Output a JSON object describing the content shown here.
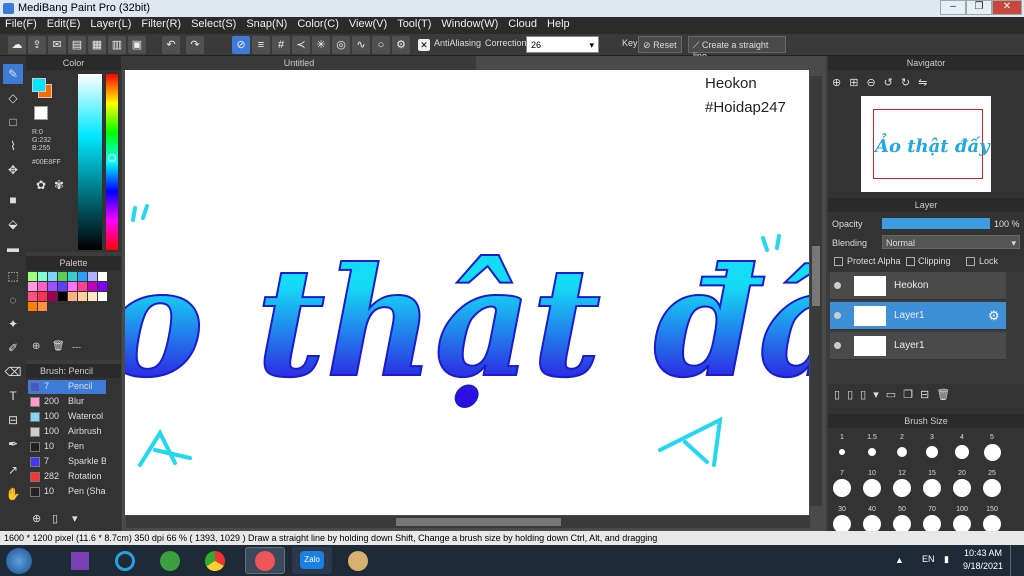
{
  "window": {
    "title": "MediBang Paint Pro (32bit)"
  },
  "menu": [
    "File(F)",
    "Edit(E)",
    "Layer(L)",
    "Filter(R)",
    "Select(S)",
    "Snap(N)",
    "Color(C)",
    "View(V)",
    "Tool(T)",
    "Window(W)",
    "Cloud",
    "Help"
  ],
  "toolbar": {
    "antialias_label": "AntiAliasing",
    "correction_label": "Correction",
    "correction_value": "26",
    "key_label": "Key",
    "reset_label": "Reset",
    "straight_label": "Create a straight line"
  },
  "canvas": {
    "title": "Untitled",
    "watermark_line1": "Heokon",
    "watermark_line2": "#Hoidap247",
    "artwork_text": "Ảo thật đấy"
  },
  "color": {
    "title": "Color",
    "r": "R:0",
    "g": "G:232",
    "b": "B:255",
    "hex": "#00E8FF",
    "primary": "#00E8FF",
    "secondary": "#FF6A00"
  },
  "palette": {
    "title": "Palette",
    "dash": "---",
    "swatches": [
      "#9dff7a",
      "#7dffcf",
      "#7dd6ff",
      "#58d058",
      "#30d0d0",
      "#2aa0ff",
      "#b0b0ff",
      "#ffffff",
      "#ff9ae0",
      "#ff5ec8",
      "#a050ff",
      "#6040ff",
      "#ff70ff",
      "#ff4090",
      "#c000c0",
      "#8000ff",
      "#ff5080",
      "#ff3050",
      "#a00050",
      "#000000",
      "#ffb080",
      "#ffd0a0",
      "#ffe8c0",
      "#ffffff",
      "#ff8000",
      "#ff9040"
    ]
  },
  "brush": {
    "title": "Brush: Pencil",
    "items": [
      {
        "n": "7",
        "name": "Pencil",
        "color": "#3a5bd6"
      },
      {
        "n": "200",
        "name": "Blur",
        "color": "#ff9ad0"
      },
      {
        "n": "100",
        "name": "Watercol",
        "color": "#7fd6ff"
      },
      {
        "n": "100",
        "name": "Airbrush",
        "color": "#cccccc"
      },
      {
        "n": "10",
        "name": "Pen",
        "color": "#222222"
      },
      {
        "n": "7",
        "name": "Sparkle B",
        "color": "#3a3aff"
      },
      {
        "n": "282",
        "name": "Rotation",
        "color": "#ff3030"
      },
      {
        "n": "10",
        "name": "Pen (Sha",
        "color": "#222222"
      }
    ]
  },
  "navigator": {
    "title": "Navigator"
  },
  "layer": {
    "title": "Layer",
    "opacity_label": "Opacity",
    "opacity_value": "100 %",
    "opacity": 1.0,
    "blending_label": "Blending",
    "blending_value": "Normal",
    "protect_label": "Protect Alpha",
    "clipping_label": "Clipping",
    "lock_label": "Lock",
    "items": [
      "Heokon",
      "Layer1",
      "Layer1"
    ]
  },
  "brushsize": {
    "title": "Brush Size",
    "sizes": [
      "1",
      "1.5",
      "2",
      "3",
      "4",
      "5",
      "7",
      "10",
      "12",
      "15",
      "20",
      "25",
      "30",
      "40",
      "50",
      "70",
      "100",
      "150"
    ]
  },
  "status": {
    "text": "1600 * 1200 pixel   (11.6 * 8.7cm)   350 dpi   66 %   ( 1393, 1029 )   Draw a straight line by holding down Shift, Change a brush size by holding down Ctrl, Alt, and dragging"
  },
  "taskbar": {
    "lang": "EN",
    "time": "10:43 AM",
    "date": "9/18/2021",
    "zalo": "Zalo"
  }
}
